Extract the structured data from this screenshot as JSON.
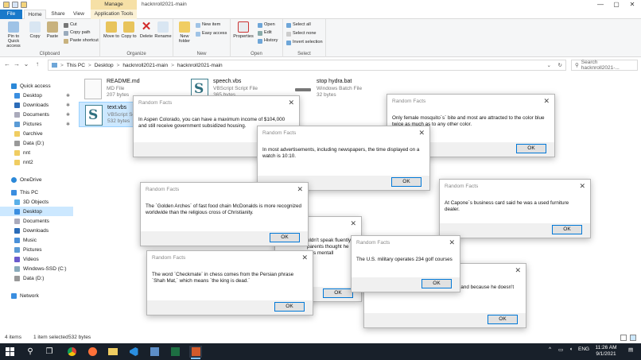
{
  "titlebar": {
    "manage_tab": "Manage",
    "window_title": "hacknroll2021-main",
    "minimize": "—",
    "maximize": "▢",
    "close": "✕"
  },
  "tabs": {
    "file": "File",
    "home": "Home",
    "share": "Share",
    "view": "View",
    "app_tools": "Application Tools",
    "help": "?"
  },
  "ribbon": {
    "clipboard": {
      "label": "Clipboard",
      "pin_quick_access": "Pin to Quick access",
      "copy": "Copy",
      "paste": "Paste",
      "cut": "Cut",
      "copy_path": "Copy path",
      "paste_shortcut": "Paste shortcut"
    },
    "organize": {
      "label": "Organize",
      "move_to": "Move to",
      "copy_to": "Copy to",
      "delete": "Delete",
      "rename": "Rename"
    },
    "new": {
      "label": "New",
      "new_folder": "New folder",
      "new_item": "New item",
      "easy_access": "Easy access"
    },
    "open": {
      "label": "Open",
      "properties": "Properties",
      "open": "Open",
      "edit": "Edit",
      "history": "History"
    },
    "select": {
      "label": "Select",
      "select_all": "Select all",
      "select_none": "Select none",
      "invert_selection": "Invert selection"
    }
  },
  "address": {
    "back": "←",
    "forward": "→",
    "recent": "⌄",
    "up": "↑",
    "path": [
      "This PC",
      "Desktop",
      "hacknroll2021-main",
      "hacknroll2021-main"
    ],
    "separator": ">",
    "dropdown": "⌄",
    "refresh": "↻",
    "search_placeholder": "Search hacknroll2021-..."
  },
  "nav": {
    "quick_access": "Quick access",
    "desktop": "Desktop",
    "downloads": "Downloads",
    "documents": "Documents",
    "pictures": "Pictures",
    "darchive": "0archive",
    "data_d": "Data (D:)",
    "nnt": "nnt",
    "nnt2": "nnt2",
    "onedrive": "OneDrive",
    "this_pc": "This PC",
    "objects3d": "3D Objects",
    "desktop2": "Desktop",
    "documents2": "Documents",
    "downloads2": "Downloads",
    "music": "Music",
    "pictures2": "Pictures",
    "videos": "Videos",
    "windows_ssd": "Windows-SSD (C:)",
    "data_d2": "Data (D:)",
    "network": "Network"
  },
  "files": [
    {
      "name": "README.md",
      "type": "MD File",
      "size": "207 bytes"
    },
    {
      "name": "speech.vbs",
      "type": "VBScript Script File",
      "size": "365 bytes"
    },
    {
      "name": "stop hydra.bat",
      "type": "Windows Batch File",
      "size": "32 bytes"
    },
    {
      "name": "text.vbs",
      "type": "VBScript Scrip",
      "size": "532 bytes"
    }
  ],
  "status": {
    "items": "4 items",
    "selected": "1 item selected",
    "size": "532 bytes"
  },
  "dialogs": {
    "title": "Random Facts",
    "ok": "OK",
    "close": "✕",
    "d1": "In Aspen Colorado, you can have a maximum income of $104,000 and still receive government subsidized housing.",
    "d2": "Only female mosquito`s` bite and most are attracted to the color blue twice as much as to any other color.",
    "d3": "In most advertisements, including newspapers, the time displayed on a watch is 10:10.",
    "d4": "The `Golden Arches` of fast food chain McDonalds is more recognized worldwide than the religious cross of Christianity.",
    "d5": "At Capone`s business card said he was a used furniture dealer.",
    "d6_partial": "uldn't speak fluently\nparents thought he was mentall",
    "d7": "The U.S. military operates 234 golf courses",
    "d8_partial": "land because he doesn't",
    "d9": "The word `Checkmate` in chess comes from the Persian phrase `Shah Mat,` which means `the king is dead.`"
  },
  "taskbar": {
    "search_icon": "⚲",
    "task_view": "❐",
    "tray_up": "^",
    "language": "ENG",
    "time": "11:26 AM",
    "date": "9/1/2021"
  }
}
